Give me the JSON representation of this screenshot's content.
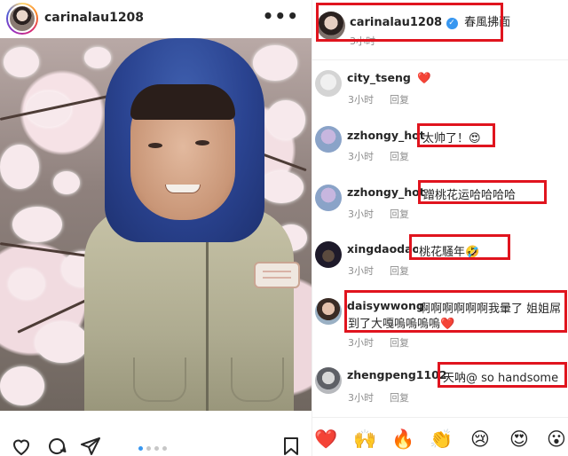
{
  "post": {
    "username": "carinalau1208",
    "more_label": "•••",
    "carousel": {
      "count": 4,
      "active_index": 0
    }
  },
  "caption": {
    "username": "carinalau1208",
    "text": "春風拂面",
    "time": "3小时"
  },
  "comments": [
    {
      "username": "city_tseng",
      "text": "❤️",
      "time": "3小时",
      "reply": "回复"
    },
    {
      "username": "zzhongy_hot",
      "text": "太帅了！😍",
      "time": "3小时",
      "reply": "回复"
    },
    {
      "username": "zzhongy_hot",
      "text": "蹭桃花运哈哈哈哈",
      "time": "3小时",
      "reply": "回复"
    },
    {
      "username": "xingdaodao",
      "text": "桃花騷年🤣",
      "time": "3小时",
      "reply": "回复"
    },
    {
      "username": "daisywwong",
      "text": "啊啊啊啊啊啊我暈了 姐姐屌",
      "text2": "到了大嘎嗚嗚嗚嗚❤️",
      "time": "3小时",
      "reply": "回复"
    },
    {
      "username": "zhengpeng1102",
      "text": "天呐@ so handsome",
      "time": "3小时",
      "reply": "回复"
    }
  ],
  "emoji_bar": [
    "❤️",
    "🙌",
    "🔥",
    "👏",
    "😢",
    "😍",
    "😮"
  ],
  "colors": {
    "highlight": "#e0141e",
    "accent": "#3897f0",
    "meta": "#8e8e8e"
  }
}
